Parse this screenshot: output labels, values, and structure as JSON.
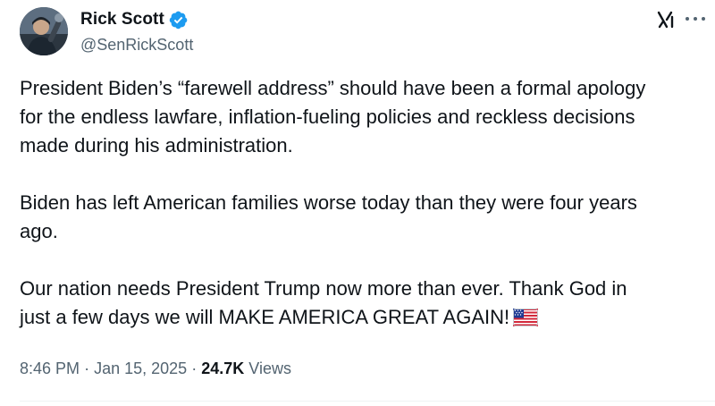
{
  "author": {
    "display_name": "Rick Scott",
    "handle": "@SenRickScott",
    "verified_icon": "verified-badge-icon",
    "avatar_icon": "avatar"
  },
  "header_icons": {
    "logo": "x-logo-icon",
    "more": "more-options-icon"
  },
  "tweet": {
    "paragraphs": [
      "President Biden’s “farewell address” should have been a formal apology\nfor the endless lawfare, inflation-fueling policies and reckless decisions\nmade during his administration.",
      "Biden has left American families worse today than they were four years\nago.",
      "Our nation needs President Trump now more than ever. Thank God in\njust a few days we will MAKE AMERICA GREAT AGAIN!"
    ],
    "trailing_emoji": "us-flag-icon"
  },
  "meta": {
    "time": "8:46 PM",
    "separator": "·",
    "date": "Jan 15, 2025",
    "views_count": "24.7K",
    "views_label": "Views"
  },
  "colors": {
    "text_primary": "#0f1419",
    "text_secondary": "#536471",
    "verified_blue": "#1d9bf0",
    "divider": "#eff3f4"
  }
}
